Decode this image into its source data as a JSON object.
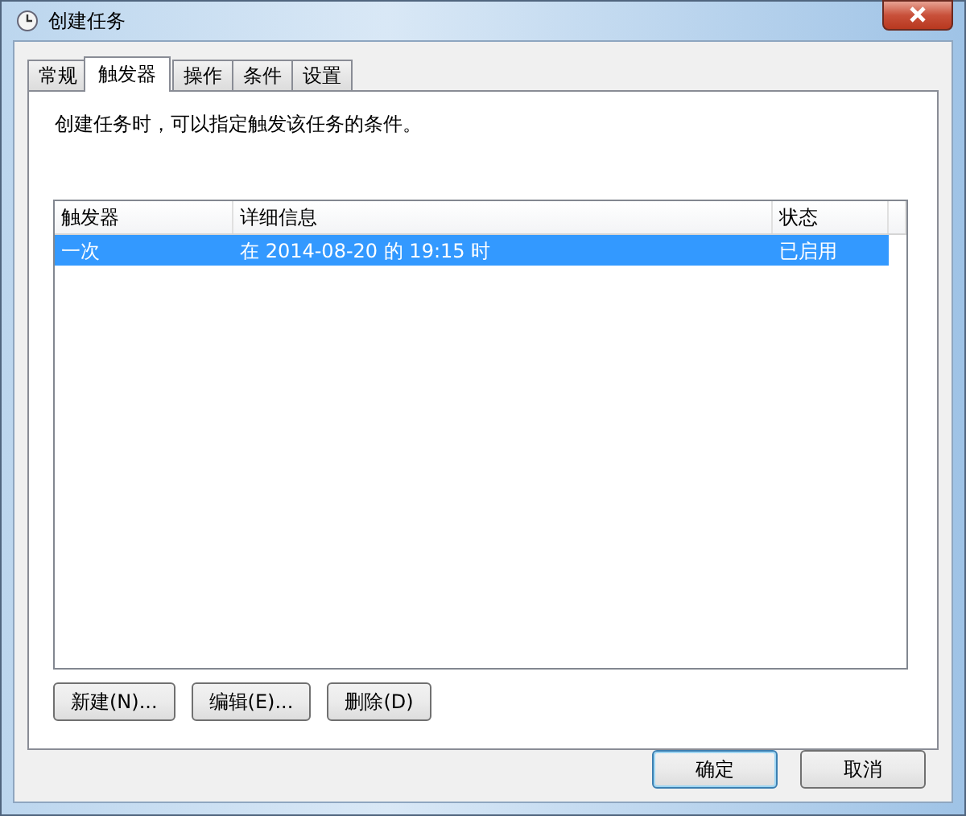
{
  "window": {
    "title": "创建任务"
  },
  "tabs": [
    {
      "label": "常规",
      "selected": false
    },
    {
      "label": "触发器",
      "selected": true
    },
    {
      "label": "操作",
      "selected": false
    },
    {
      "label": "条件",
      "selected": false
    },
    {
      "label": "设置",
      "selected": false
    }
  ],
  "description": "创建任务时，可以指定触发该任务的条件。",
  "table": {
    "columns": [
      "触发器",
      "详细信息",
      "状态"
    ],
    "rows": [
      {
        "cells": [
          "一次",
          "在 2014-08-20 的 19:15 时",
          "已启用"
        ],
        "selected": true
      }
    ]
  },
  "actions": [
    "新建(N)...",
    "编辑(E)...",
    "删除(D)"
  ],
  "buttons": [
    "确定",
    "取消"
  ]
}
